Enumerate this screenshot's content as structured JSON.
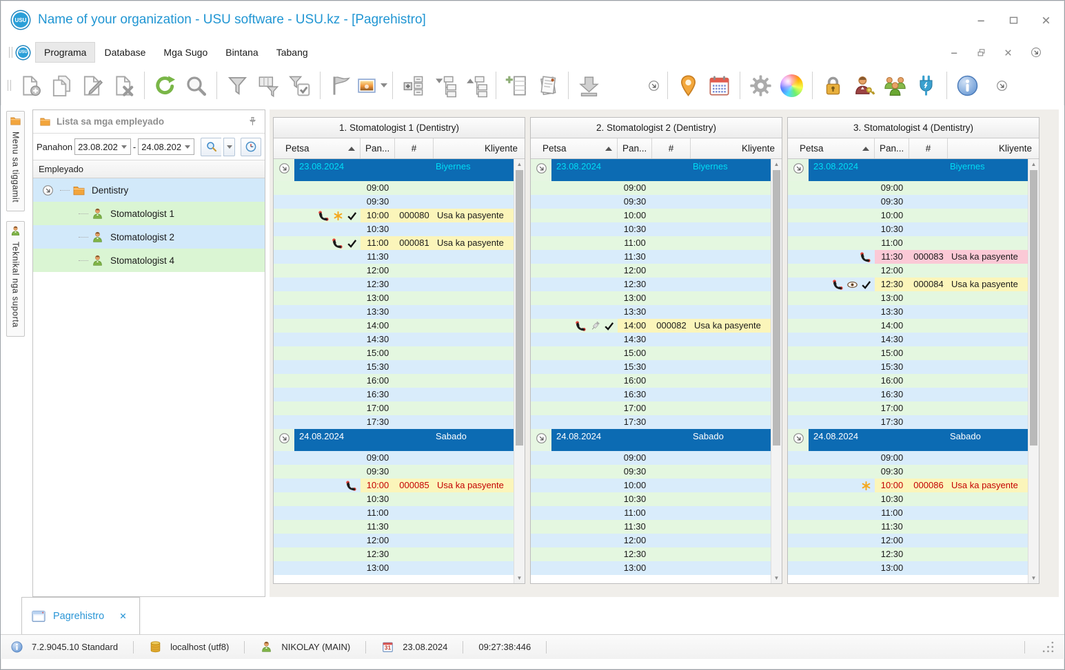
{
  "window": {
    "title": "Name of your organization - USU software - USU.kz - [Pagrehistro]",
    "logo_text": "USU"
  },
  "menu": {
    "items": [
      "Programa",
      "Database",
      "Mga Sugo",
      "Bintana",
      "Tabang"
    ],
    "active": "Programa"
  },
  "toolbar": {
    "groups": [
      {
        "icons": [
          "doc-new",
          "doc-copy",
          "doc-edit",
          "doc-delete"
        ]
      },
      {
        "icons": [
          "refresh",
          "search"
        ]
      },
      {
        "icons": [
          "filter",
          "filter-layout",
          "filter-check"
        ]
      },
      {
        "icons": [
          "flag",
          "image-preview"
        ]
      },
      {
        "icons": [
          "tree-plus",
          "tree-collapse",
          "tree-expand"
        ]
      },
      {
        "icons": [
          "add-table",
          "report"
        ]
      },
      {
        "icons": [
          "export"
        ]
      },
      {
        "icons": [
          "chevron-circle"
        ],
        "small": true,
        "nosep": true,
        "gap": 58
      },
      {
        "icons": [
          "location",
          "calendar"
        ]
      },
      {
        "icons": [
          "settings",
          "colors"
        ]
      },
      {
        "icons": [
          "lock",
          "user-key",
          "users",
          "plug"
        ]
      },
      {
        "icons": [
          "info"
        ]
      },
      {
        "icons": [
          "chevron-circle"
        ],
        "small": true,
        "nosep": true,
        "gap": 14
      }
    ]
  },
  "sidebar": {
    "tabs": [
      {
        "label": "Menu sa tiggamit",
        "icon": "folder"
      },
      {
        "label": "Teknikal nga suporta",
        "icon": "person"
      }
    ],
    "panel": {
      "title": "Lista sa mga empleyado",
      "filter_label": "Panahon",
      "date_from": "23.08.202",
      "date_to": "24.08.202",
      "range_separator": "-",
      "grid_header": "Empleyado",
      "tree": {
        "root": "Dentistry",
        "children": [
          "Stomatologist 1",
          "Stomatologist 2",
          "Stomatologist 4"
        ]
      }
    }
  },
  "schedule": {
    "columns": {
      "date": "Petsa",
      "time": "Pan...",
      "number": "#",
      "client": "Kliyente"
    },
    "panels": [
      {
        "title": "1. Stomatologist 1 (Dentistry)",
        "days": [
          {
            "date": "23.08.2024",
            "weekday": "Biyernes",
            "current": true,
            "slots": [
              {
                "time": "09:00"
              },
              {
                "time": "09:30"
              },
              {
                "time": "10:00",
                "number": "000080",
                "client": "Usa ka pasyente",
                "icons": [
                  "phone",
                  "star",
                  "check"
                ],
                "bg": "yellow",
                "text": "black"
              },
              {
                "time": "10:30"
              },
              {
                "time": "11:00",
                "number": "000081",
                "client": "Usa ka pasyente",
                "icons": [
                  "phone",
                  "check"
                ],
                "bg": "yellow",
                "text": "black"
              },
              {
                "time": "11:30"
              },
              {
                "time": "12:00"
              },
              {
                "time": "12:30"
              },
              {
                "time": "13:00"
              },
              {
                "time": "13:30"
              },
              {
                "time": "14:00"
              },
              {
                "time": "14:30"
              },
              {
                "time": "15:00"
              },
              {
                "time": "15:30"
              },
              {
                "time": "16:00"
              },
              {
                "time": "16:30"
              },
              {
                "time": "17:00"
              },
              {
                "time": "17:30"
              }
            ]
          },
          {
            "date": "24.08.2024",
            "weekday": "Sabado",
            "current": false,
            "slots": [
              {
                "time": "09:00"
              },
              {
                "time": "09:30"
              },
              {
                "time": "10:00",
                "number": "000085",
                "client": "Usa ka pasyente",
                "icons": [
                  "phone"
                ],
                "bg": "yellow",
                "text": "red"
              },
              {
                "time": "10:30"
              },
              {
                "time": "11:00"
              },
              {
                "time": "11:30"
              },
              {
                "time": "12:00"
              },
              {
                "time": "12:30"
              },
              {
                "time": "13:00"
              }
            ]
          }
        ]
      },
      {
        "title": "2. Stomatologist 2 (Dentistry)",
        "days": [
          {
            "date": "23.08.2024",
            "weekday": "Biyernes",
            "current": true,
            "slots": [
              {
                "time": "09:00"
              },
              {
                "time": "09:30"
              },
              {
                "time": "10:00"
              },
              {
                "time": "10:30"
              },
              {
                "time": "11:00"
              },
              {
                "time": "11:30"
              },
              {
                "time": "12:00"
              },
              {
                "time": "12:30"
              },
              {
                "time": "13:00"
              },
              {
                "time": "13:30"
              },
              {
                "time": "14:00",
                "number": "000082",
                "client": "Usa ka pasyente",
                "icons": [
                  "phone",
                  "syringe",
                  "check"
                ],
                "bg": "yellow",
                "text": "black"
              },
              {
                "time": "14:30"
              },
              {
                "time": "15:00"
              },
              {
                "time": "15:30"
              },
              {
                "time": "16:00"
              },
              {
                "time": "16:30"
              },
              {
                "time": "17:00"
              },
              {
                "time": "17:30"
              }
            ]
          },
          {
            "date": "24.08.2024",
            "weekday": "Sabado",
            "current": false,
            "slots": [
              {
                "time": "09:00"
              },
              {
                "time": "09:30"
              },
              {
                "time": "10:00"
              },
              {
                "time": "10:30"
              },
              {
                "time": "11:00"
              },
              {
                "time": "11:30"
              },
              {
                "time": "12:00"
              },
              {
                "time": "12:30"
              },
              {
                "time": "13:00"
              }
            ]
          }
        ]
      },
      {
        "title": "3. Stomatologist 4 (Dentistry)",
        "days": [
          {
            "date": "23.08.2024",
            "weekday": "Biyernes",
            "current": true,
            "slots": [
              {
                "time": "09:00"
              },
              {
                "time": "09:30"
              },
              {
                "time": "10:00"
              },
              {
                "time": "10:30"
              },
              {
                "time": "11:00"
              },
              {
                "time": "11:30",
                "number": "000083",
                "client": "Usa ka pasyente",
                "icons": [
                  "phone"
                ],
                "bg": "pink",
                "text": "black"
              },
              {
                "time": "12:00"
              },
              {
                "time": "12:30",
                "number": "000084",
                "client": "Usa ka pasyente",
                "icons": [
                  "phone",
                  "eye",
                  "check"
                ],
                "bg": "yellow",
                "text": "black"
              },
              {
                "time": "13:00"
              },
              {
                "time": "13:30"
              },
              {
                "time": "14:00"
              },
              {
                "time": "14:30"
              },
              {
                "time": "15:00"
              },
              {
                "time": "15:30"
              },
              {
                "time": "16:00"
              },
              {
                "time": "16:30"
              },
              {
                "time": "17:00"
              },
              {
                "time": "17:30"
              }
            ]
          },
          {
            "date": "24.08.2024",
            "weekday": "Sabado",
            "current": false,
            "slots": [
              {
                "time": "09:00"
              },
              {
                "time": "09:30"
              },
              {
                "time": "10:00",
                "number": "000086",
                "client": "Usa ka pasyente",
                "icons": [
                  "star"
                ],
                "bg": "yellow",
                "text": "red"
              },
              {
                "time": "10:30"
              },
              {
                "time": "11:00"
              },
              {
                "time": "11:30"
              },
              {
                "time": "12:00"
              },
              {
                "time": "12:30"
              },
              {
                "time": "13:00"
              }
            ]
          }
        ]
      }
    ]
  },
  "tabbar": {
    "active_tab": "Pagrehistro"
  },
  "statusbar": {
    "version": "7.2.9045.10 Standard",
    "database": "localhost (utf8)",
    "user": "NIKOLAY (MAIN)",
    "date": "23.08.2024",
    "time": "09:27:38:446"
  },
  "colors": {
    "accent_blue": "#2196d3",
    "day_header_bg": "#0c6bb3",
    "current_day_text": "#00dcf5",
    "row_green": "#e4f7e0",
    "row_blue": "#d9ecfb",
    "appointment_yellow": "#fbf5ba",
    "appointment_pink": "#fbc9d6",
    "unconfirmed_red": "#c40000"
  }
}
